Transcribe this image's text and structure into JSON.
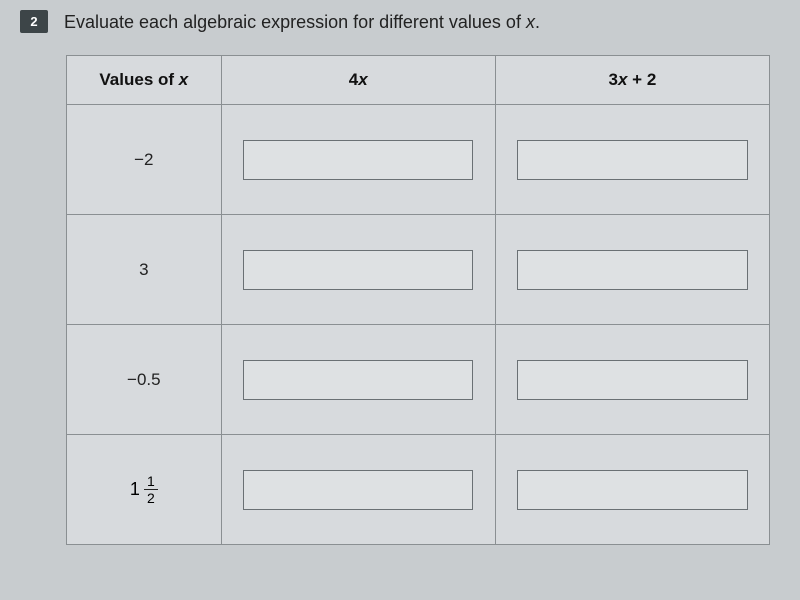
{
  "question": {
    "number": "2",
    "text_before": "Evaluate each algebraic expression for different values of ",
    "var": "x",
    "text_after": "."
  },
  "table": {
    "headers": {
      "col1_before": "Values of ",
      "col1_var": "x",
      "col2_before": "4",
      "col2_var": "x",
      "col3_before": "3",
      "col3_var": "x",
      "col3_after": " + 2"
    },
    "rows": [
      {
        "x_value": "−2",
        "is_fraction": false
      },
      {
        "x_value": "3",
        "is_fraction": false
      },
      {
        "x_value": "−0.5",
        "is_fraction": false
      },
      {
        "x_value": "1 1/2",
        "is_fraction": true,
        "whole": "1",
        "num": "1",
        "den": "2"
      }
    ]
  }
}
